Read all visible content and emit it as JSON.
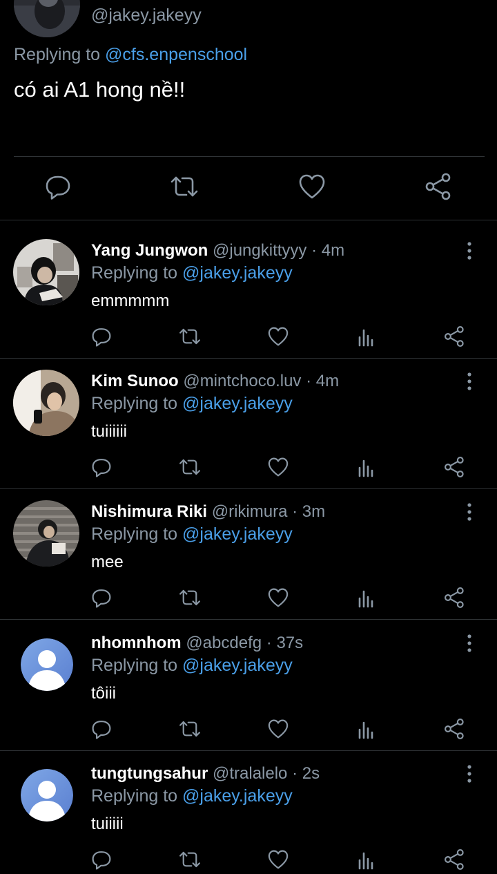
{
  "main_tweet": {
    "handle": "@jakey.jakeyy",
    "replying_prefix": "Replying to ",
    "replying_mention": "@cfs.enpenschool",
    "text": "có ai A1 hong nề!!"
  },
  "replies": [
    {
      "name": "Yang Jungwon",
      "handle": "@jungkittyyy",
      "separator": "·",
      "time": "4m",
      "replying_prefix": "Replying to ",
      "replying_mention": "@jakey.jakeyy",
      "text": "emmmmm"
    },
    {
      "name": "Kim Sunoo",
      "handle": "@mintchoco.luv",
      "separator": "·",
      "time": "4m",
      "replying_prefix": "Replying to ",
      "replying_mention": "@jakey.jakeyy",
      "text": "tuiiiiii"
    },
    {
      "name": "Nishimura Riki",
      "handle": "@rikimura",
      "separator": "·",
      "time": "3m",
      "replying_prefix": "Replying to ",
      "replying_mention": "@jakey.jakeyy",
      "text": "mee"
    },
    {
      "name": "nhomnhom",
      "handle": "@abcdefg",
      "separator": "·",
      "time": "37s",
      "replying_prefix": "Replying to ",
      "replying_mention": "@jakey.jakeyy",
      "text": "tôiii"
    },
    {
      "name": "tungtungsahur",
      "handle": "@tralalelo",
      "separator": "·",
      "time": "2s",
      "replying_prefix": "Replying to ",
      "replying_mention": "@jakey.jakeyy",
      "text": "tuiiiii"
    }
  ],
  "icons": {
    "reply": "reply-icon",
    "retweet": "retweet-icon",
    "like": "like-icon",
    "views": "views-icon",
    "share": "share-icon",
    "more": "more-icon",
    "default_avatar": "default-avatar-icon"
  },
  "colors": {
    "background": "#000000",
    "text": "#ffffff",
    "muted": "#8b98a5",
    "accent": "#4a9fe8",
    "divider": "#2f3336",
    "icon": "#8b98a5"
  }
}
